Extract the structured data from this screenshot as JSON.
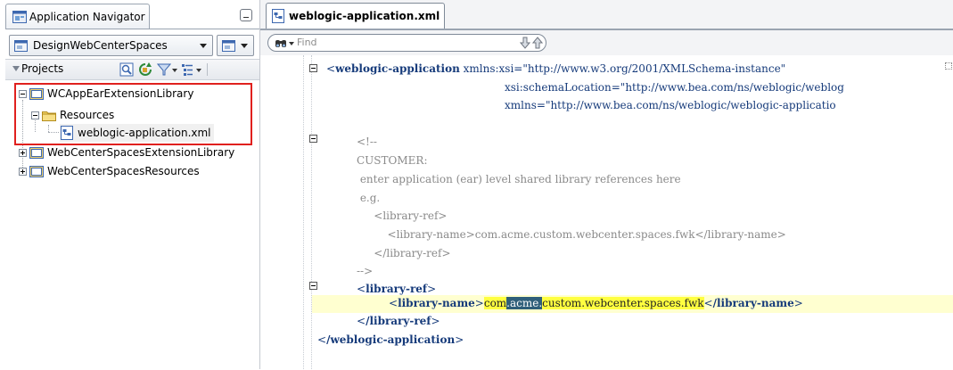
{
  "navigator": {
    "tab_title": "Application Navigator",
    "application_select": {
      "value": "DesignWebCenterSpaces"
    },
    "projects_label": "Projects",
    "tree": [
      {
        "label": "WCAppEarExtensionLibrary",
        "expanded": true,
        "highlighted": true
      },
      {
        "label": "Resources",
        "expanded": true,
        "highlighted": true
      },
      {
        "label": "weblogic-application.xml",
        "selected": true,
        "highlighted": true
      },
      {
        "label": "WebCenterSpacesExtensionLibrary",
        "expanded": false
      },
      {
        "label": "WebCenterSpacesResources",
        "expanded": false
      }
    ]
  },
  "editor": {
    "tab_title": "weblogic-application.xml",
    "find_placeholder": "Find",
    "code": {
      "l1_open": "<",
      "l1_tag": "weblogic-application",
      "l1_attr1": " xmlns:xsi=",
      "l1_val1": "\"http://www.w3.org/2001/XMLSchema-instance\"",
      "l2_attr": "xsi:schemaLocation=",
      "l2_val": "\"http://www.bea.com/ns/weblogic/weblog",
      "l3_attr": "xmlns=",
      "l3_val": "\"http://www.bea.com/ns/weblogic/weblogic-applicatio",
      "c1": "<!--",
      "c2": "CUSTOMER:",
      "c3": " enter application (ear) level shared library references here",
      "c4": " e.g.",
      "c5": "    <library-ref>",
      "c6": "        <library-name>com.acme.custom.webcenter.spaces.fwk</library-name>",
      "c7": "    </library-ref>",
      "c8": "-->",
      "lr_open": "library-ref",
      "ln_tag": "library-name",
      "ln_val_a": "com",
      "ln_val_b": ".acme.",
      "ln_val_c": "custom.webcenter.spaces.fwk",
      "ln_close_tag": "/library-name",
      "lr_close": "/library-ref",
      "wa_close": "/weblogic-application"
    }
  },
  "colors": {
    "highlight_box": "#e0201e",
    "current_line": "#ffffd0",
    "search_match": "#ffff40",
    "tag_color": "#153a7a"
  }
}
